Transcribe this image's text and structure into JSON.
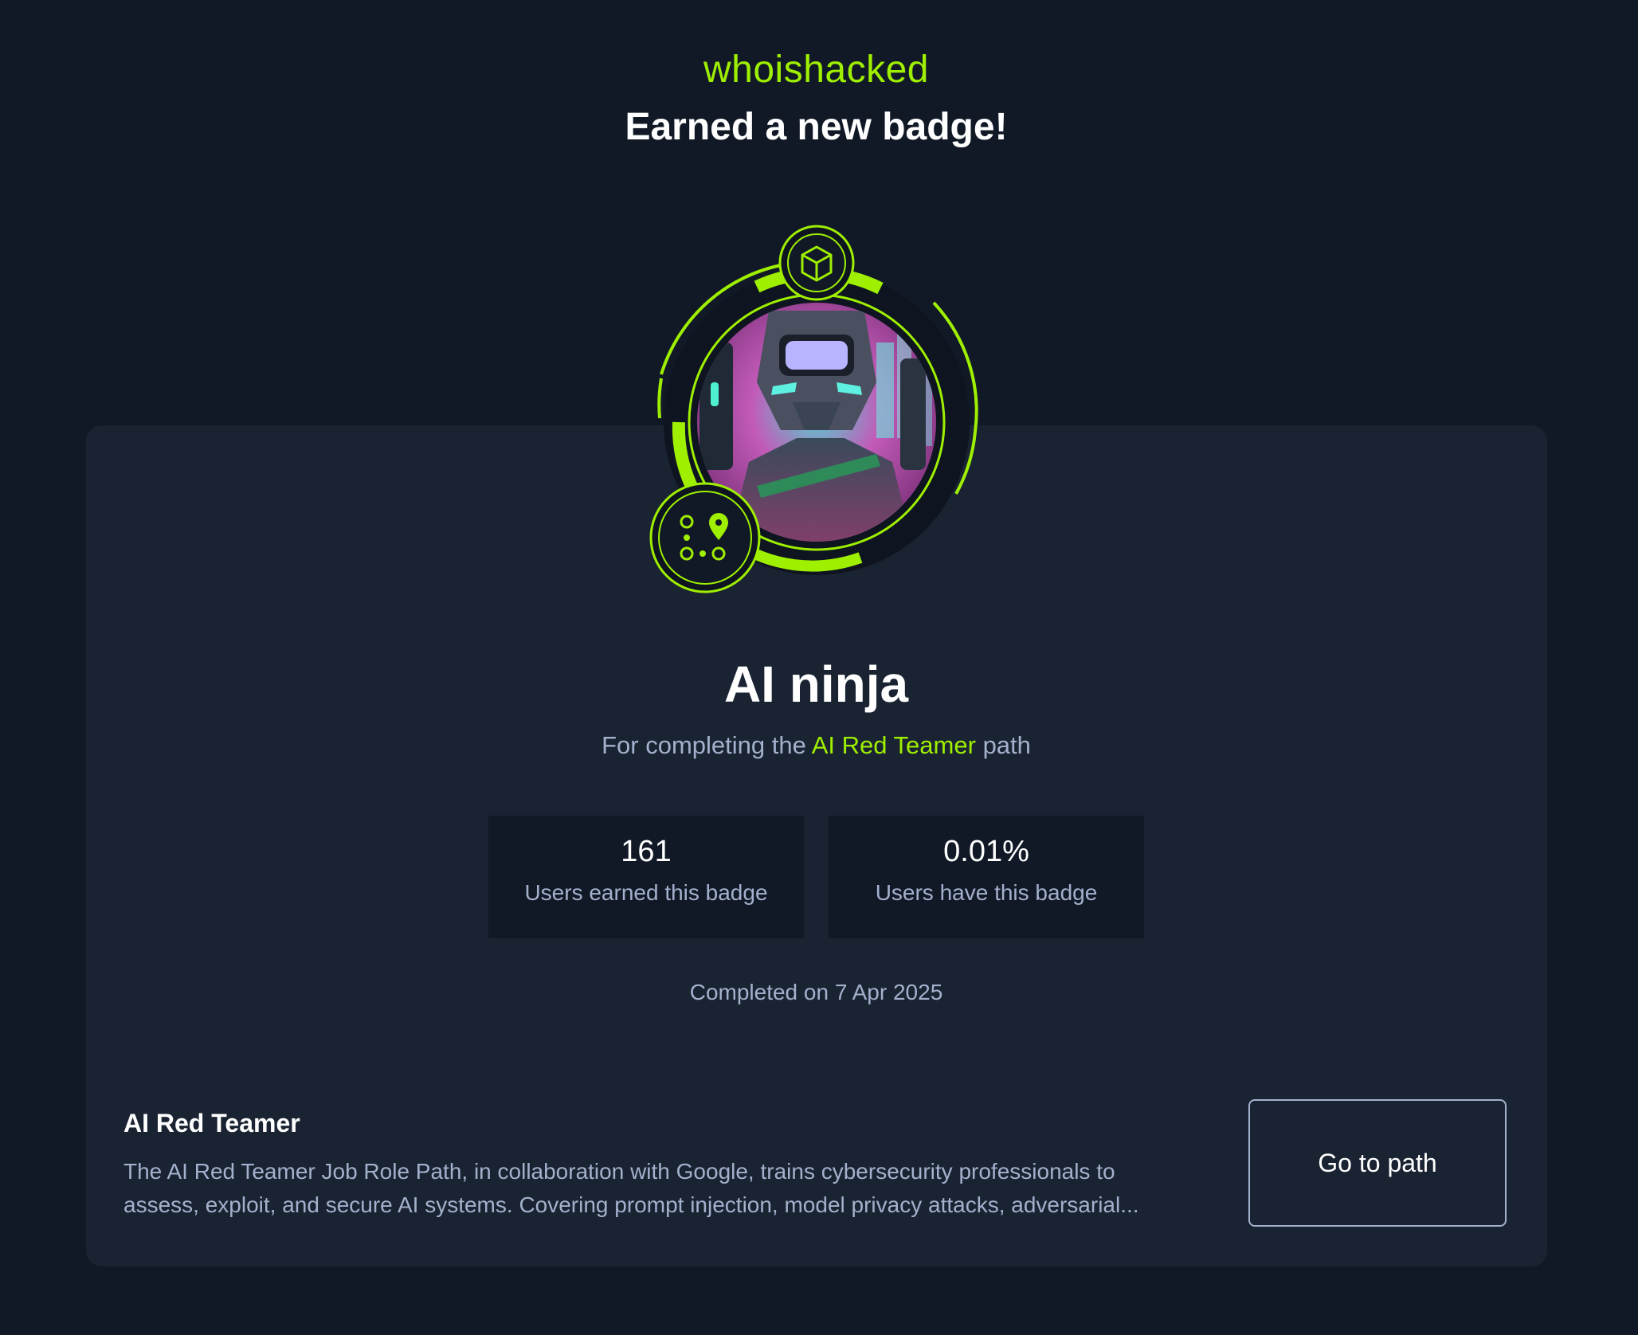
{
  "header": {
    "username": "whoishacked",
    "headline": "Earned a new badge!"
  },
  "badge": {
    "name": "AI ninja",
    "subtitle_prefix": "For completing the",
    "path_link": "AI Red Teamer",
    "subtitle_suffix": "path",
    "top_icon": "cube-icon",
    "bottom_icon": "path-map-pin-icon",
    "accent_color": "#9fef00"
  },
  "stats": [
    {
      "value": "161",
      "label": "Users earned this badge"
    },
    {
      "value": "0.01%",
      "label": "Users have this badge"
    }
  ],
  "completed": "Completed on 7 Apr 2025",
  "path": {
    "title": "AI Red Teamer",
    "description": "The AI Red Teamer Job Role Path, in collaboration with Google, trains cybersecurity professionals to assess, exploit, and secure AI systems. Covering prompt injection, model privacy attacks, adversarial...",
    "button_label": "Go to path"
  }
}
